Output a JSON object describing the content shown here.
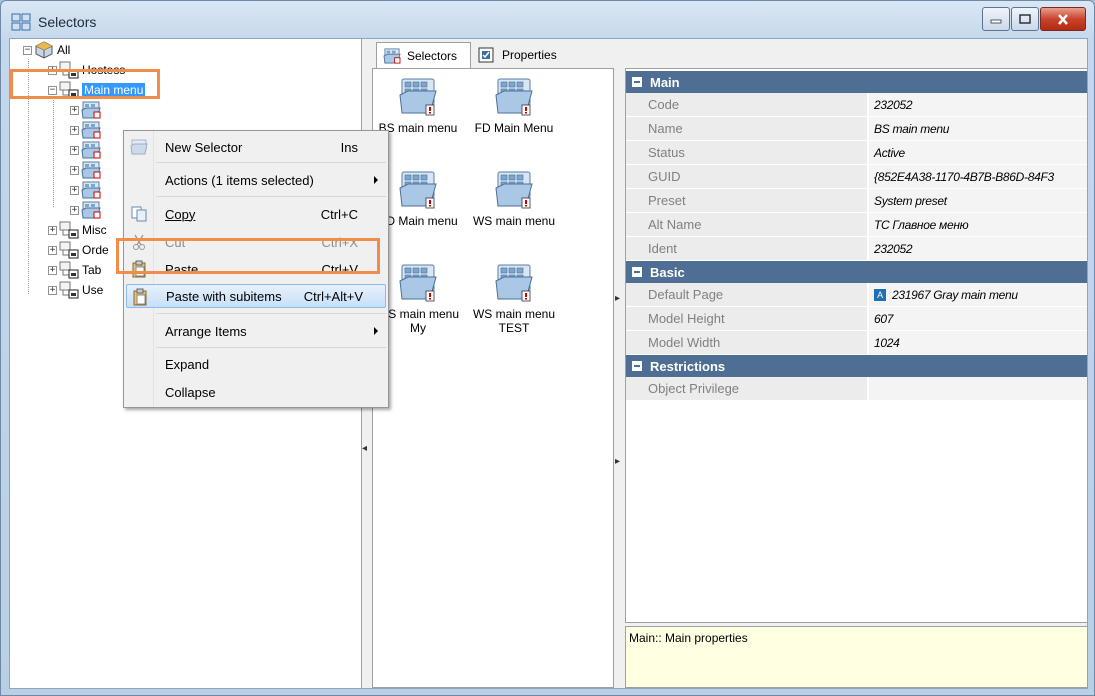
{
  "window": {
    "title": "Selectors",
    "buttons": [
      "minimize",
      "maximize",
      "close"
    ]
  },
  "tree": {
    "root": "All",
    "items": [
      {
        "label": "Hostess"
      },
      {
        "label": "Main menu",
        "selected": true
      },
      {
        "label": "Misc"
      },
      {
        "label": "Orde"
      },
      {
        "label": "Tab"
      },
      {
        "label": "Use"
      }
    ]
  },
  "tabs": [
    {
      "label": "Selectors",
      "active": true,
      "icon": "selectors-icon"
    },
    {
      "label": "Properties",
      "active": false,
      "icon": "properties-icon"
    }
  ],
  "icon_items": [
    {
      "label": "BS main menu"
    },
    {
      "label": "FD Main Menu"
    },
    {
      "label": "SD Main menu"
    },
    {
      "label": "WS main menu"
    },
    {
      "label": "WS main menu My"
    },
    {
      "label": "WS main menu TEST"
    }
  ],
  "context_menu": {
    "items": [
      {
        "label": "New Selector",
        "shortcut": "Ins"
      },
      {
        "label": "Actions (1 items selected)",
        "submenu": true
      },
      {
        "label": "Copy",
        "shortcut": "Ctrl+C"
      },
      {
        "label": "Cut",
        "shortcut": "Ctrl+X",
        "disabled": true
      },
      {
        "label": "Paste",
        "shortcut": "Ctrl+V"
      },
      {
        "label": "Paste with subitems",
        "shortcut": "Ctrl+Alt+V",
        "highlighted": true
      },
      {
        "label": "Arrange Items",
        "submenu": true
      },
      {
        "label": "Expand"
      },
      {
        "label": "Collapse"
      }
    ]
  },
  "properties": {
    "main": {
      "category": "Main",
      "rows": [
        {
          "name": "Code",
          "value": "232052"
        },
        {
          "name": "Name",
          "value": "BS main menu"
        },
        {
          "name": "Status",
          "value": "Active"
        },
        {
          "name": "GUID",
          "value": "{852E4A38-1170-4B7B-B86D-84F3"
        },
        {
          "name": "Preset",
          "value": "System preset"
        },
        {
          "name": "Alt Name",
          "value": "ТС Главное меню"
        },
        {
          "name": "Ident",
          "value": "232052"
        }
      ]
    },
    "basic": {
      "category": "Basic",
      "rows": [
        {
          "name": "Default Page",
          "value": "231967 Gray main menu",
          "badge": "A"
        },
        {
          "name": "Model Height",
          "value": "607"
        },
        {
          "name": "Model Width",
          "value": "1024"
        }
      ]
    },
    "restrictions": {
      "category": "Restrictions",
      "rows": [
        {
          "name": "Object Privilege",
          "value": ""
        }
      ]
    }
  },
  "description": "Main:: Main properties",
  "colors": {
    "category_bar": "#4e6f93",
    "selection": "#3399ff",
    "highlight_outline": "#f28c4a",
    "description_bg": "#ffffe1"
  }
}
